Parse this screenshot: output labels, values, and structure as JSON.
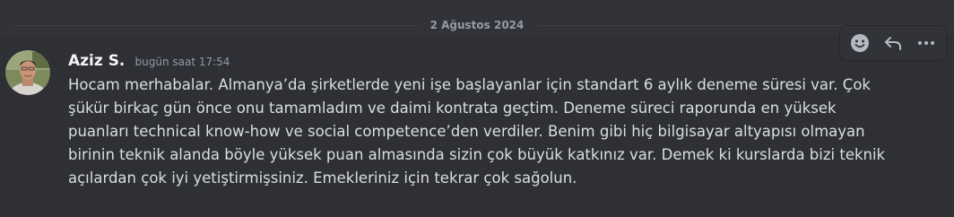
{
  "divider": {
    "date": "2 Ağustos 2024"
  },
  "message": {
    "author": "Aziz S.",
    "timestamp": "bugün saat 17:54",
    "lines": [
      "Hocam merhabalar. Almanya’da şirketlerde yeni işe başlayanlar için standart 6 aylık deneme süresi var. Çok",
      "şükür birkaç gün önce onu tamamladım ve daimi kontrata geçtim. Deneme süreci raporunda en yüksek",
      "puanları technical know-how ve social competence’den verdiler. Benim gibi hiç bilgisayar altyapısı olmayan",
      "birinin teknik alanda böyle yüksek puan almasında sizin çok büyük katkınız var. Demek ki kurslarda bizi teknik",
      "açılardan çok iyi yetiştirmişsiniz. Emekleriniz için tekrar çok sağolun."
    ]
  },
  "toolbar": {
    "icons": [
      "add-reaction-icon",
      "reply-icon",
      "more-options-icon"
    ]
  },
  "colors": {
    "background": "#313338",
    "hover_background": "#2e3035",
    "username": "#f2f3f5",
    "text": "#dbdee1",
    "muted": "#949ba4"
  }
}
